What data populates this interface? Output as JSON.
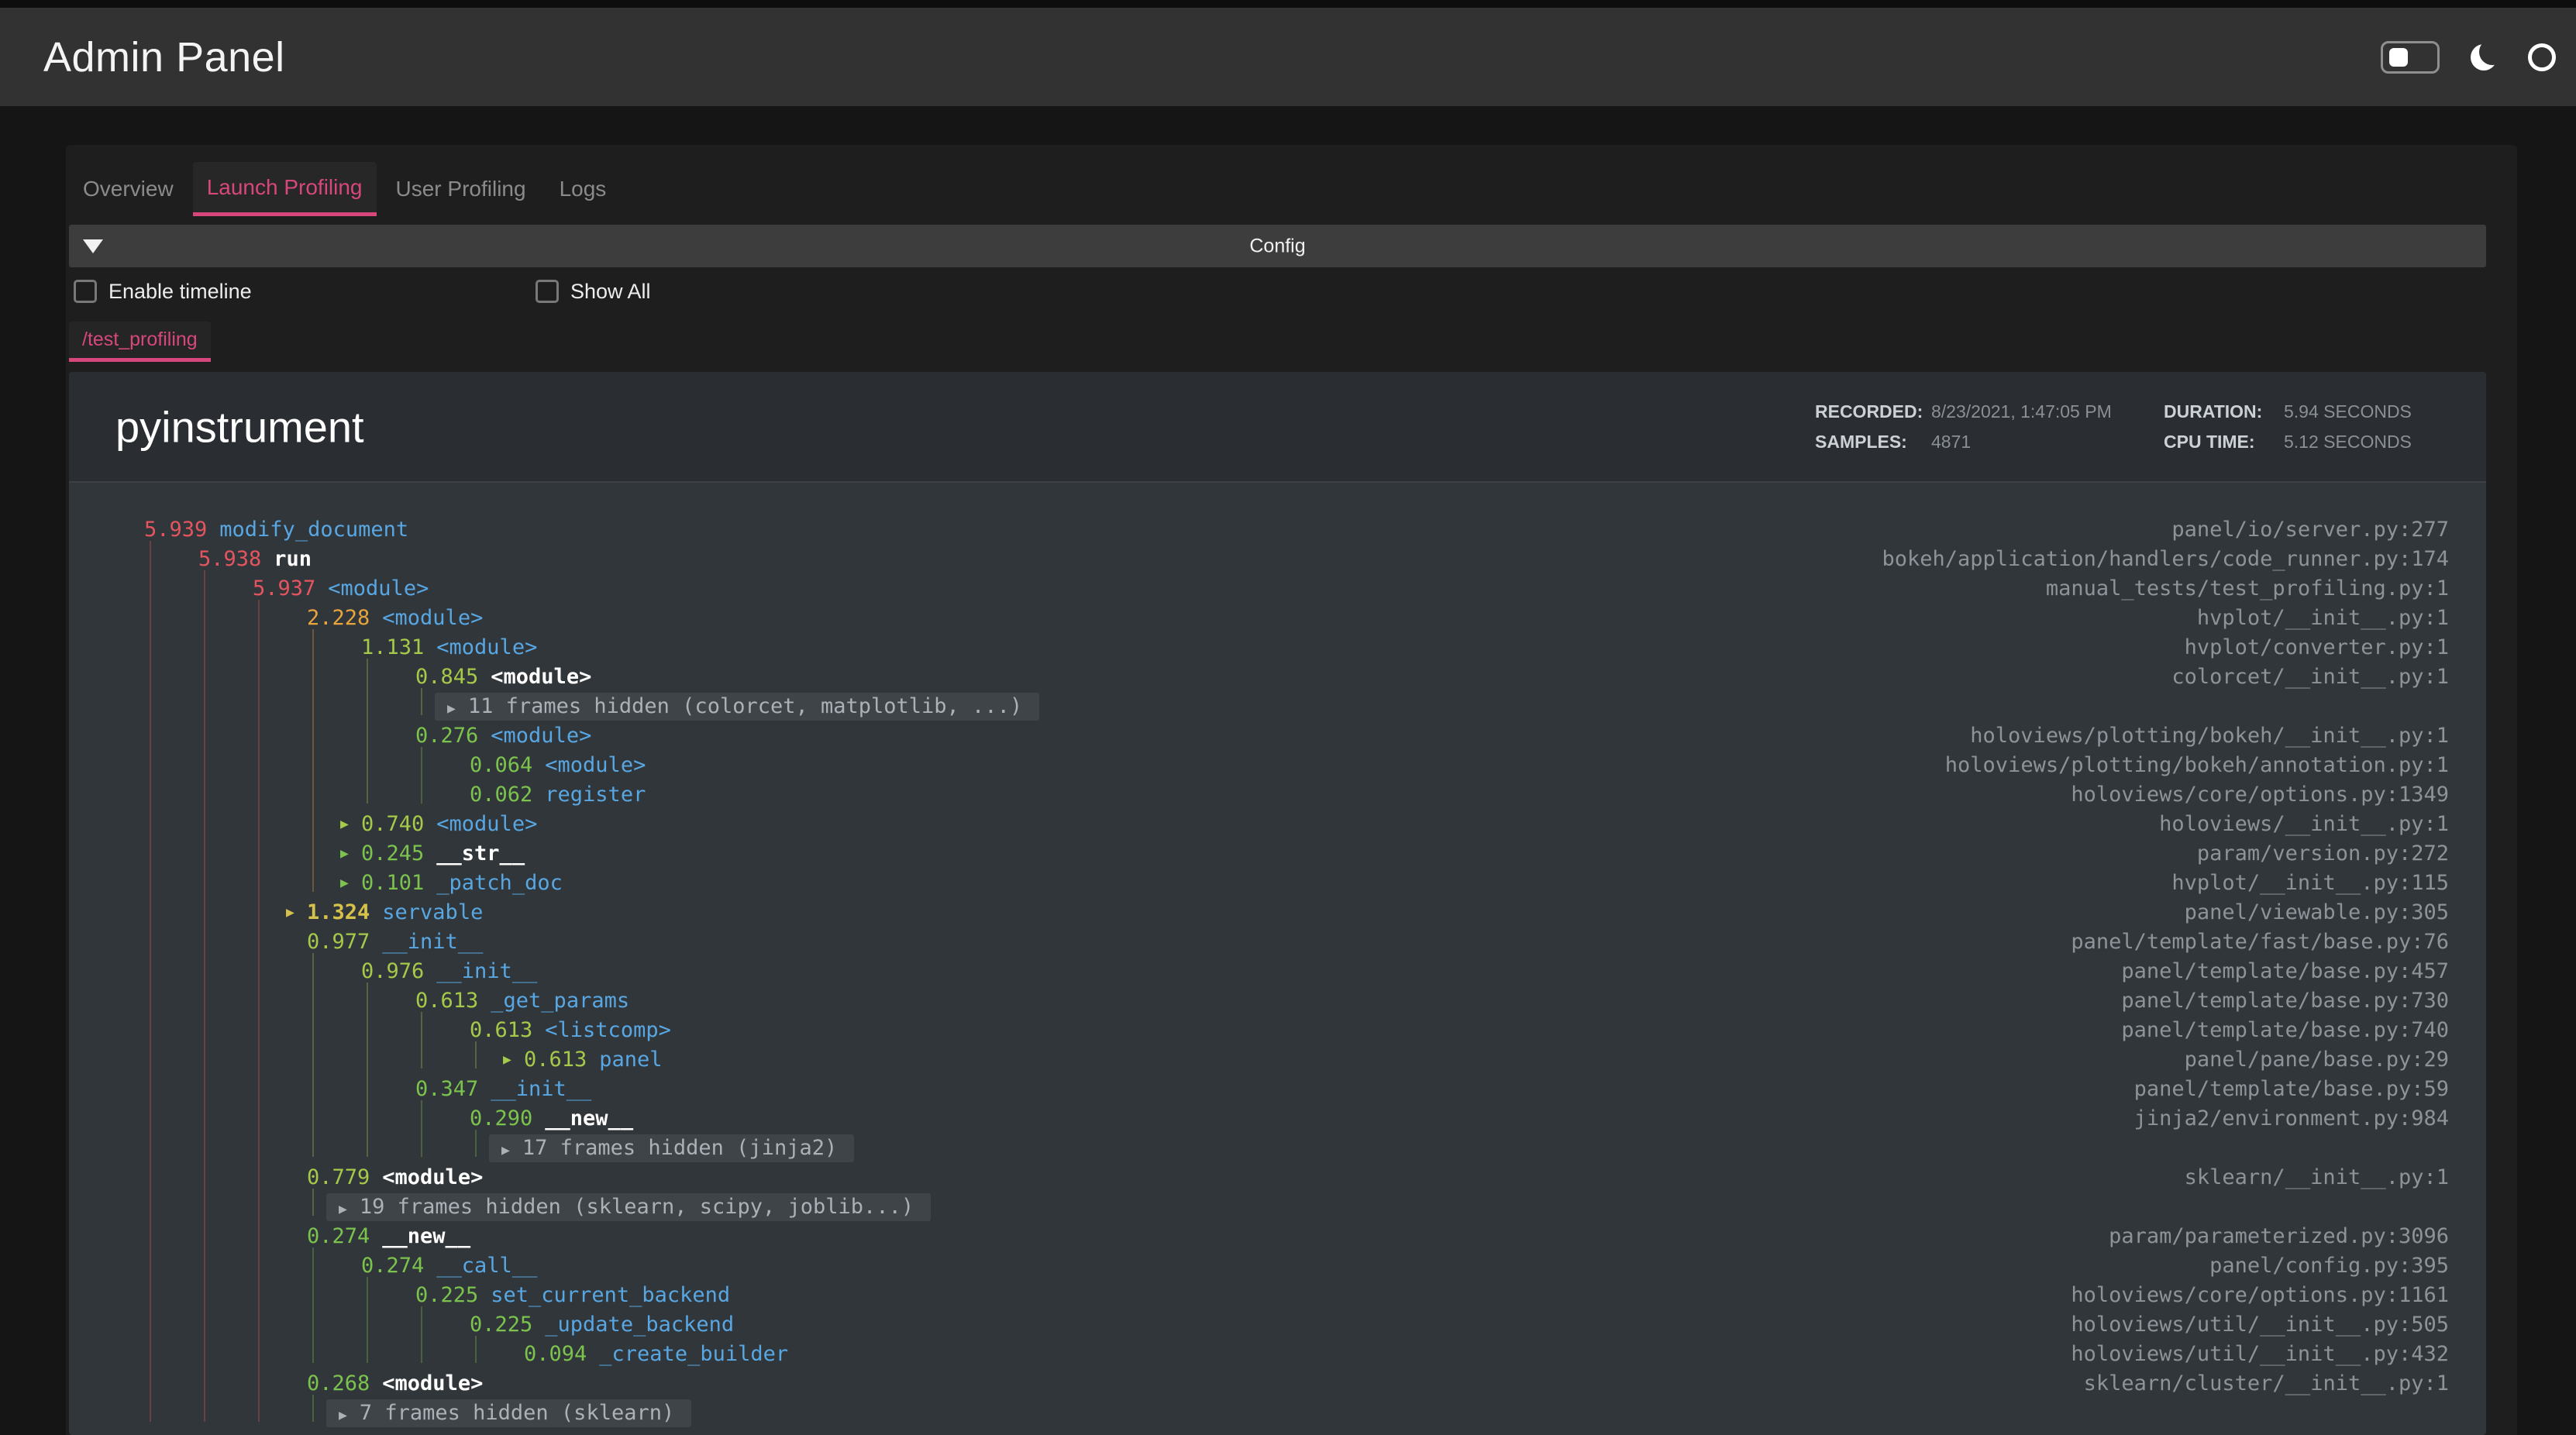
{
  "header": {
    "title": "Admin Panel",
    "icons": [
      "theme-toggle",
      "moon-icon",
      "busy-indicator"
    ]
  },
  "tabs": {
    "items": [
      {
        "label": "Overview",
        "active": false
      },
      {
        "label": "Launch Profiling",
        "active": true
      },
      {
        "label": "User Profiling",
        "active": false
      },
      {
        "label": "Logs",
        "active": false
      }
    ]
  },
  "config": {
    "title": "Config",
    "collapse_icon": "triangle-down",
    "checkboxes": [
      {
        "label": "Enable timeline",
        "checked": false
      },
      {
        "label": "Show All",
        "checked": false
      }
    ]
  },
  "profiler": {
    "endpoint_tab": "/test_profiling",
    "title": "pyinstrument",
    "meta": {
      "recorded_label": "RECORDED:",
      "recorded": "8/23/2021, 1:47:05 PM",
      "samples_label": "SAMPLES:",
      "samples": "4871",
      "duration_label": "DURATION:",
      "duration": "5.94 SECONDS",
      "cpu_label": "CPU TIME:",
      "cpu": "5.12 SECONDS"
    },
    "rows": [
      {
        "time": "5.939",
        "name": "modify_document",
        "level": 0,
        "time_color": "red",
        "name_color": "blue",
        "collapsed": false,
        "path": "panel/io/server.py:277"
      },
      {
        "time": "5.938",
        "name": "run",
        "level": 1,
        "time_color": "red",
        "name_color": "white",
        "collapsed": false,
        "path": "bokeh/application/handlers/code_runner.py:174"
      },
      {
        "time": "5.937",
        "name": "<module>",
        "level": 2,
        "time_color": "red",
        "name_color": "blue",
        "collapsed": false,
        "path": "manual_tests/test_profiling.py:1"
      },
      {
        "time": "2.228",
        "name": "<module>",
        "level": 3,
        "time_color": "orange",
        "name_color": "blue",
        "collapsed": false,
        "path": "hvplot/__init__.py:1"
      },
      {
        "time": "1.131",
        "name": "<module>",
        "level": 4,
        "time_color": "lime",
        "name_color": "blue",
        "collapsed": false,
        "path": "hvplot/converter.py:1"
      },
      {
        "time": "0.845",
        "name": "<module>",
        "level": 5,
        "time_color": "lime",
        "name_color": "white",
        "collapsed": false,
        "path": "colorcet/__init__.py:1"
      },
      {
        "hidden_label": "11 frames hidden (colorcet, matplotlib, ...)",
        "level": 6
      },
      {
        "time": "0.276",
        "name": "<module>",
        "level": 5,
        "time_color": "green",
        "name_color": "blue",
        "collapsed": false,
        "path": "holoviews/plotting/bokeh/__init__.py:1"
      },
      {
        "time": "0.064",
        "name": "<module>",
        "level": 6,
        "time_color": "green",
        "name_color": "blue",
        "collapsed": false,
        "path": "holoviews/plotting/bokeh/annotation.py:1"
      },
      {
        "time": "0.062",
        "name": "register",
        "level": 6,
        "time_color": "green",
        "name_color": "blue",
        "collapsed": false,
        "path": "holoviews/core/options.py:1349"
      },
      {
        "time": "0.740",
        "name": "<module>",
        "level": 4,
        "time_color": "lime",
        "name_color": "blue",
        "collapsed": true,
        "path": "holoviews/__init__.py:1"
      },
      {
        "time": "0.245",
        "name": "__str__",
        "level": 4,
        "time_color": "green",
        "name_color": "white",
        "collapsed": true,
        "path": "param/version.py:272"
      },
      {
        "time": "0.101",
        "name": "_patch_doc",
        "level": 4,
        "time_color": "green",
        "name_color": "blue",
        "collapsed": true,
        "path": "hvplot/__init__.py:115"
      },
      {
        "time": "1.324",
        "name": "servable",
        "level": 3,
        "time_color": "yellow",
        "name_color": "blue",
        "collapsed": true,
        "bold": true,
        "path": "panel/viewable.py:305"
      },
      {
        "time": "0.977",
        "name": "__init__",
        "level": 3,
        "time_color": "lime",
        "name_color": "blue",
        "collapsed": false,
        "path": "panel/template/fast/base.py:76"
      },
      {
        "time": "0.976",
        "name": "__init__",
        "level": 4,
        "time_color": "lime",
        "name_color": "blue",
        "collapsed": false,
        "path": "panel/template/base.py:457"
      },
      {
        "time": "0.613",
        "name": "_get_params",
        "level": 5,
        "time_color": "lime",
        "name_color": "blue",
        "collapsed": false,
        "path": "panel/template/base.py:730"
      },
      {
        "time": "0.613",
        "name": "<listcomp>",
        "level": 6,
        "time_color": "lime",
        "name_color": "blue",
        "collapsed": false,
        "path": "panel/template/base.py:740"
      },
      {
        "time": "0.613",
        "name": "panel",
        "level": 7,
        "time_color": "lime",
        "name_color": "blue",
        "collapsed": true,
        "path": "panel/pane/base.py:29"
      },
      {
        "time": "0.347",
        "name": "__init__",
        "level": 5,
        "time_color": "green",
        "name_color": "blue",
        "collapsed": false,
        "path": "panel/template/base.py:59"
      },
      {
        "time": "0.290",
        "name": "__new__",
        "level": 6,
        "time_color": "green",
        "name_color": "white",
        "collapsed": false,
        "path": "jinja2/environment.py:984"
      },
      {
        "hidden_label": "17 frames hidden (jinja2)",
        "level": 7
      },
      {
        "time": "0.779",
        "name": "<module>",
        "level": 3,
        "time_color": "lime",
        "name_color": "white",
        "collapsed": false,
        "path": "sklearn/__init__.py:1"
      },
      {
        "hidden_label": "19 frames hidden (sklearn, scipy, joblib...)",
        "level": 4
      },
      {
        "time": "0.274",
        "name": "__new__",
        "level": 3,
        "time_color": "green",
        "name_color": "white",
        "collapsed": false,
        "path": "param/parameterized.py:3096"
      },
      {
        "time": "0.274",
        "name": "__call__",
        "level": 4,
        "time_color": "green",
        "name_color": "blue",
        "collapsed": false,
        "path": "panel/config.py:395"
      },
      {
        "time": "0.225",
        "name": "set_current_backend",
        "level": 5,
        "time_color": "green",
        "name_color": "blue",
        "collapsed": false,
        "path": "holoviews/core/options.py:1161"
      },
      {
        "time": "0.225",
        "name": "_update_backend",
        "level": 6,
        "time_color": "green",
        "name_color": "blue",
        "collapsed": false,
        "path": "holoviews/util/__init__.py:505"
      },
      {
        "time": "0.094",
        "name": "_create_builder",
        "level": 7,
        "time_color": "green",
        "name_color": "blue",
        "collapsed": false,
        "path": "holoviews/util/__init__.py:432"
      },
      {
        "time": "0.268",
        "name": "<module>",
        "level": 3,
        "time_color": "green",
        "name_color": "white",
        "collapsed": false,
        "path": "sklearn/cluster/__init__.py:1"
      },
      {
        "hidden_label": "7 frames hidden (sklearn)",
        "level": 4
      }
    ]
  },
  "colors": {
    "accent": "#d8477c",
    "red": "#e4555f",
    "orange": "#e8a43d",
    "yellow": "#d6c24a",
    "lime": "#a6c94a",
    "green": "#7cc34e",
    "blue": "#58a7e3",
    "white": "#ffffff",
    "path_text": "#8d9399",
    "hidden_bg": "#3f4449",
    "hidden_text": "#abb1b6"
  }
}
